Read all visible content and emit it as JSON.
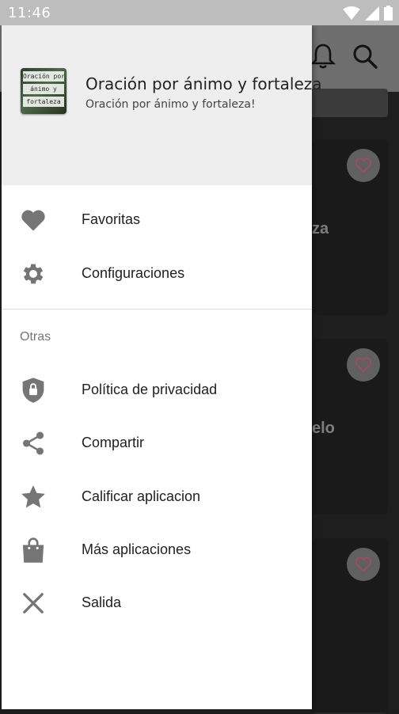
{
  "status_bar": {
    "time": "11:46",
    "icons": [
      "wifi-icon",
      "cell-signal-icon",
      "battery-icon"
    ]
  },
  "drawer": {
    "app_icon_text": [
      "Oración por",
      "ánimo y",
      "fortaleza"
    ],
    "title": "Oración por ánimo y fortaleza",
    "subtitle": "Oración por ánimo y fortaleza!",
    "primary_items": [
      {
        "label": "Favoritas",
        "icon": "heart-icon"
      },
      {
        "label": "Configuraciones",
        "icon": "gear-icon"
      }
    ],
    "section_title": "Otras",
    "secondary_items": [
      {
        "label": "Política de privacidad",
        "icon": "shield-lock-icon"
      },
      {
        "label": "Compartir",
        "icon": "share-icon"
      },
      {
        "label": "Calificar aplicacion",
        "icon": "star-icon"
      },
      {
        "label": "Más aplicaciones",
        "icon": "shopping-bag-icon"
      },
      {
        "label": "Salida",
        "icon": "close-icon"
      }
    ]
  },
  "background": {
    "toolbar_icons": [
      "bell-icon",
      "search-icon"
    ],
    "card_fragments": [
      "za",
      "elo",
      ""
    ]
  },
  "colors": {
    "drawer_header": "#eeeeee",
    "icon_gray": "#757575",
    "status_bar": "#bdbdbd",
    "fav_heart": "#e0708a"
  }
}
